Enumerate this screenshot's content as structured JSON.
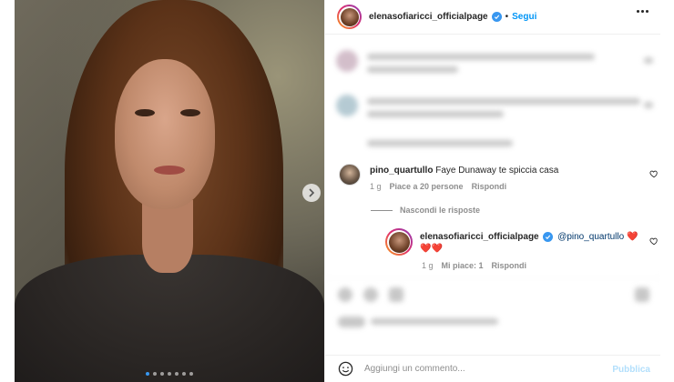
{
  "post": {
    "author": "elenasofiaricci_officialpage",
    "separator": "•",
    "follow_label": "Segui",
    "carousel": {
      "count": 7,
      "active_index": 0
    }
  },
  "comments": [
    {
      "username": "pino_quartullo",
      "text": "Faye Dunaway te spiccia casa",
      "time": "1 g",
      "likes": "Piace a 20 persone",
      "reply_label": "Rispondi"
    }
  ],
  "hide_replies_label": "Nascondi le risposte",
  "reply": {
    "username": "elenasofiaricci_officialpage",
    "mention": "@pino_quartullo",
    "hearts_line1": "❤️",
    "hearts_line2": "❤️❤️",
    "time": "1 g",
    "likes": "Mi piace: 1",
    "reply_label": "Rispondi"
  },
  "composer": {
    "placeholder": "Aggiungi un commento...",
    "publish_label": "Pubblica"
  },
  "colors": {
    "link_blue": "#0095f6",
    "verified_blue": "#3897f0",
    "publish_disabled": "#b2dffc",
    "heart_red": "#ed4956"
  }
}
